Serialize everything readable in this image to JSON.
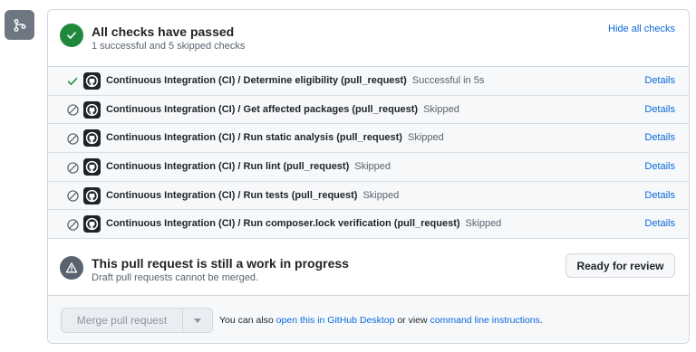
{
  "summary": {
    "title": "All checks have passed",
    "subtitle": "1 successful and 5 skipped checks",
    "hide_label": "Hide all checks"
  },
  "checks": [
    {
      "name": "Continuous Integration (CI) / Determine eligibility (pull_request)",
      "status": "Successful in 5s",
      "state": "success",
      "details": "Details"
    },
    {
      "name": "Continuous Integration (CI) / Get affected packages (pull_request)",
      "status": "Skipped",
      "state": "skipped",
      "details": "Details"
    },
    {
      "name": "Continuous Integration (CI) / Run static analysis (pull_request)",
      "status": "Skipped",
      "state": "skipped",
      "details": "Details"
    },
    {
      "name": "Continuous Integration (CI) / Run lint (pull_request)",
      "status": "Skipped",
      "state": "skipped",
      "details": "Details"
    },
    {
      "name": "Continuous Integration (CI) / Run tests (pull_request)",
      "status": "Skipped",
      "state": "skipped",
      "details": "Details"
    },
    {
      "name": "Continuous Integration (CI) / Run composer.lock verification (pull_request)",
      "status": "Skipped",
      "state": "skipped",
      "details": "Details"
    }
  ],
  "wip": {
    "title": "This pull request is still a work in progress",
    "subtitle": "Draft pull requests cannot be merged.",
    "ready_label": "Ready for review"
  },
  "merge": {
    "button_label": "Merge pull request",
    "note_prefix": "You can also ",
    "desktop_link": "open this in GitHub Desktop",
    "note_middle": " or view ",
    "cli_link": "command line instructions",
    "note_suffix": "."
  },
  "colors": {
    "success": "#1f883d",
    "link": "#0969da",
    "muted": "#59636e"
  }
}
